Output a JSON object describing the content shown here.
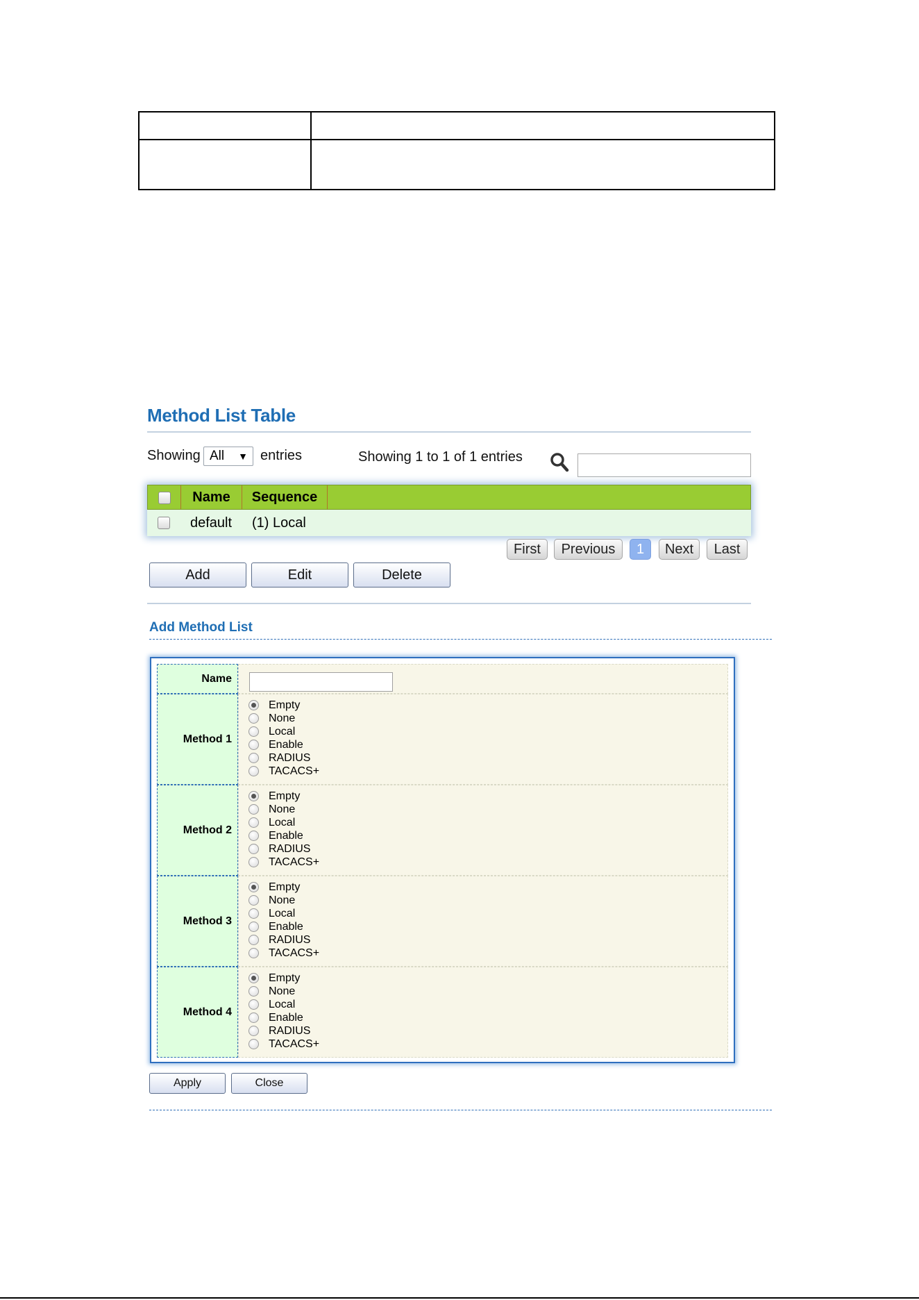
{
  "page": {
    "title": "Method List Table"
  },
  "showing": {
    "prefix": "Showing",
    "select_value": "All",
    "suffix": "entries",
    "summary": "Showing 1 to 1 of 1 entries"
  },
  "table": {
    "columns": [
      "Name",
      "Sequence"
    ],
    "rows": [
      {
        "name": "default",
        "sequence": "(1) Local"
      }
    ],
    "header_color": "#99cc33",
    "row_color": "#e6f8e6"
  },
  "pagination": {
    "first": "First",
    "previous": "Previous",
    "current": "1",
    "next": "Next",
    "last": "Last"
  },
  "actions": {
    "add": "Add",
    "edit": "Edit",
    "delete": "Delete"
  },
  "form": {
    "section_title": "Add Method List",
    "name_label": "Name",
    "methods": [
      {
        "label": "Method 1",
        "selected": "Empty"
      },
      {
        "label": "Method 2",
        "selected": "Empty"
      },
      {
        "label": "Method 3",
        "selected": "Empty"
      },
      {
        "label": "Method 4",
        "selected": "Empty"
      }
    ],
    "options": [
      "Empty",
      "None",
      "Local",
      "Enable",
      "RADIUS",
      "TACACS+"
    ],
    "apply": "Apply",
    "close": "Close"
  },
  "colors": {
    "accent": "#1f6eb4",
    "label_bg": "#dfffdf",
    "value_bg": "#f8f6e8"
  }
}
